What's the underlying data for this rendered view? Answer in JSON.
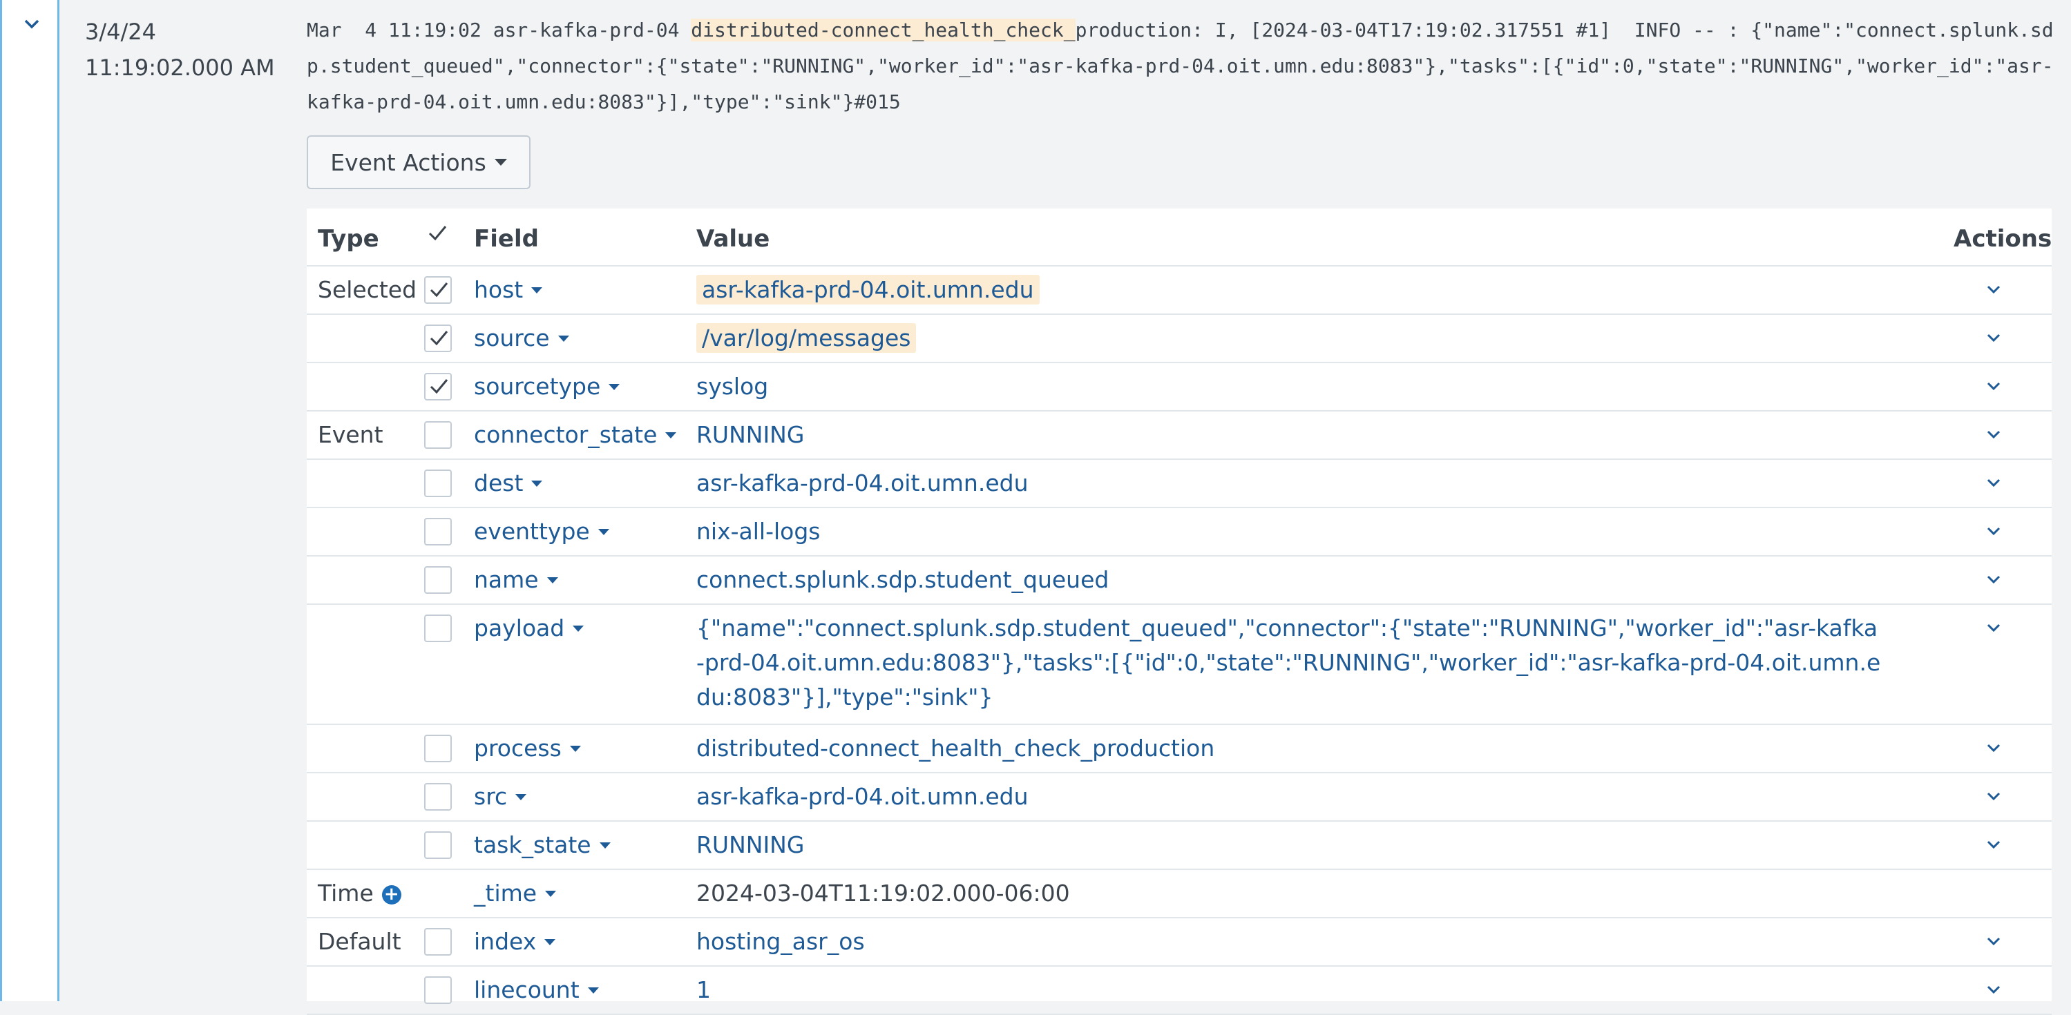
{
  "event": {
    "date": "3/4/24",
    "time": "11:19:02.000 AM",
    "raw_prefix": "Mar  4 11:19:02 asr-kafka-prd-04 ",
    "raw_highlight": "distributed-connect_health_check_",
    "raw_suffix": "production: I, [2024-03-04T17:19:02.317551 #1]  INFO -- : {\"name\":\"connect.splunk.sdp.student_queued\",\"connector\":{\"state\":\"RUNNING\",\"worker_id\":\"asr-kafka-prd-04.oit.umn.edu:8083\"},\"tasks\":[{\"id\":0,\"state\":\"RUNNING\",\"worker_id\":\"asr-kafka-prd-04.oit.umn.edu:8083\"}],\"type\":\"sink\"}#015"
  },
  "event_actions_label": "Event Actions",
  "table": {
    "headers": {
      "type": "Type",
      "field": "Field",
      "value": "Value",
      "actions": "Actions"
    },
    "rows": [
      {
        "type": "Selected",
        "checked": true,
        "field": "host",
        "value": "asr-kafka-prd-04.oit.umn.edu",
        "highlight": true
      },
      {
        "type": "",
        "checked": true,
        "field": "source",
        "value": "/var/log/messages",
        "highlight": true
      },
      {
        "type": "",
        "checked": true,
        "field": "sourcetype",
        "value": "syslog"
      },
      {
        "type": "Event",
        "checked": false,
        "field": "connector_state",
        "value": "RUNNING"
      },
      {
        "type": "",
        "checked": false,
        "field": "dest",
        "value": "asr-kafka-prd-04.oit.umn.edu"
      },
      {
        "type": "",
        "checked": false,
        "field": "eventtype",
        "value": "nix-all-logs"
      },
      {
        "type": "",
        "checked": false,
        "field": "name",
        "value": "connect.splunk.sdp.student_queued"
      },
      {
        "type": "",
        "checked": false,
        "field": "payload",
        "value": "{\"name\":\"connect.splunk.sdp.student_queued\",\"connector\":{\"state\":\"RUNNING\",\"worker_id\":\"asr-kafka-prd-04.oit.umn.edu:8083\"},\"tasks\":[{\"id\":0,\"state\":\"RUNNING\",\"worker_id\":\"asr-kafka-prd-04.oit.umn.edu:8083\"}],\"type\":\"sink\"}"
      },
      {
        "type": "",
        "checked": false,
        "field": "process",
        "value": "distributed-connect_health_check_production"
      },
      {
        "type": "",
        "checked": false,
        "field": "src",
        "value": "asr-kafka-prd-04.oit.umn.edu"
      },
      {
        "type": "",
        "checked": false,
        "field": "task_state",
        "value": "RUNNING"
      },
      {
        "type": "Time",
        "checked": null,
        "field": "_time",
        "value": "2024-03-04T11:19:02.000-06:00",
        "plain": true
      },
      {
        "type": "Default",
        "checked": false,
        "field": "index",
        "value": "hosting_asr_os"
      },
      {
        "type": "",
        "checked": false,
        "field": "linecount",
        "value": "1"
      }
    ]
  },
  "colors": {
    "link": "#1e5a96",
    "highlight": "#fbecd3",
    "gutter_border": "#6fb7e6"
  }
}
